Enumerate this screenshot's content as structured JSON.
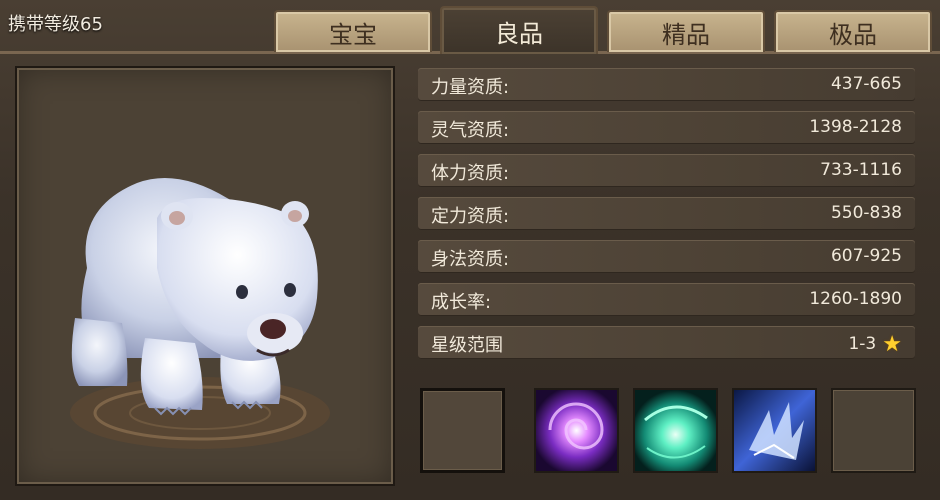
{
  "header": {
    "carry_level": "携带等级65"
  },
  "tabs": [
    {
      "label": "宝宝",
      "active": false
    },
    {
      "label": "良品",
      "active": true
    },
    {
      "label": "精品",
      "active": false
    },
    {
      "label": "极品",
      "active": false
    }
  ],
  "attributes": [
    {
      "label": "力量资质:",
      "value": "437-665"
    },
    {
      "label": "灵气资质:",
      "value": "1398-2128"
    },
    {
      "label": "体力资质:",
      "value": "733-1116"
    },
    {
      "label": "定力资质:",
      "value": "550-838"
    },
    {
      "label": "身法资质:",
      "value": "607-925"
    },
    {
      "label": "成长率:",
      "value": "1260-1890"
    },
    {
      "label": "星级范围",
      "value": "1-3"
    }
  ],
  "skills": [
    {
      "icon": "empty-slot",
      "selected": true
    },
    {
      "icon": "purple-vortex-skill-icon"
    },
    {
      "icon": "green-heal-skill-icon"
    },
    {
      "icon": "ice-claw-skill-icon"
    },
    {
      "icon": "empty-slot"
    }
  ],
  "colors": {
    "accent_star": "#ffcf2e",
    "panel": "#4c4235",
    "tab_inactive": "#b9a47f"
  }
}
